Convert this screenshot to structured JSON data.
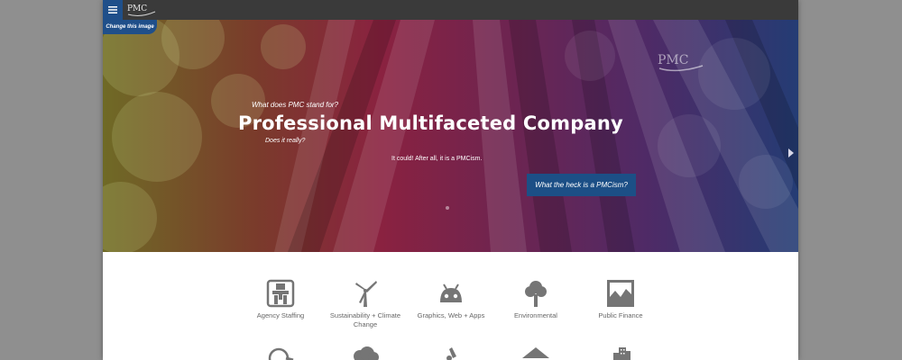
{
  "header": {
    "menu_icon": "hamburger-icon",
    "logo_text": "PMC",
    "change_image_label": "Change this image"
  },
  "hero": {
    "logo_text": "PMC",
    "question": "What does PMC stand for?",
    "title": "Professional Multifaceted Company",
    "subquestion": "Does it really?",
    "tagline": "It could! After all, it is a PMCism.",
    "cta_label": "What the heck is a PMCism?",
    "next_icon": "chevron-right-icon",
    "slide_count": 2,
    "active_slide": 1
  },
  "services": {
    "row1": [
      {
        "label": "Agency Staffing",
        "icon": "agency-staffing-icon"
      },
      {
        "label": "Sustainability + Climate Change",
        "icon": "wind-turbine-icon"
      },
      {
        "label": "Graphics, Web + Apps",
        "icon": "android-icon"
      },
      {
        "label": "Environmental",
        "icon": "tree-icon"
      },
      {
        "label": "Public Finance",
        "icon": "chart-image-icon"
      }
    ],
    "row2_icons": [
      "magnifier-icon",
      "cloud-icon",
      "microscope-icon",
      "house-icon",
      "buildings-icon"
    ]
  },
  "colors": {
    "page_background": "#8f8f8f",
    "topbar": "#3a3a3a",
    "accent_blue": "#1f4f8a",
    "icon_gray": "#757575"
  }
}
